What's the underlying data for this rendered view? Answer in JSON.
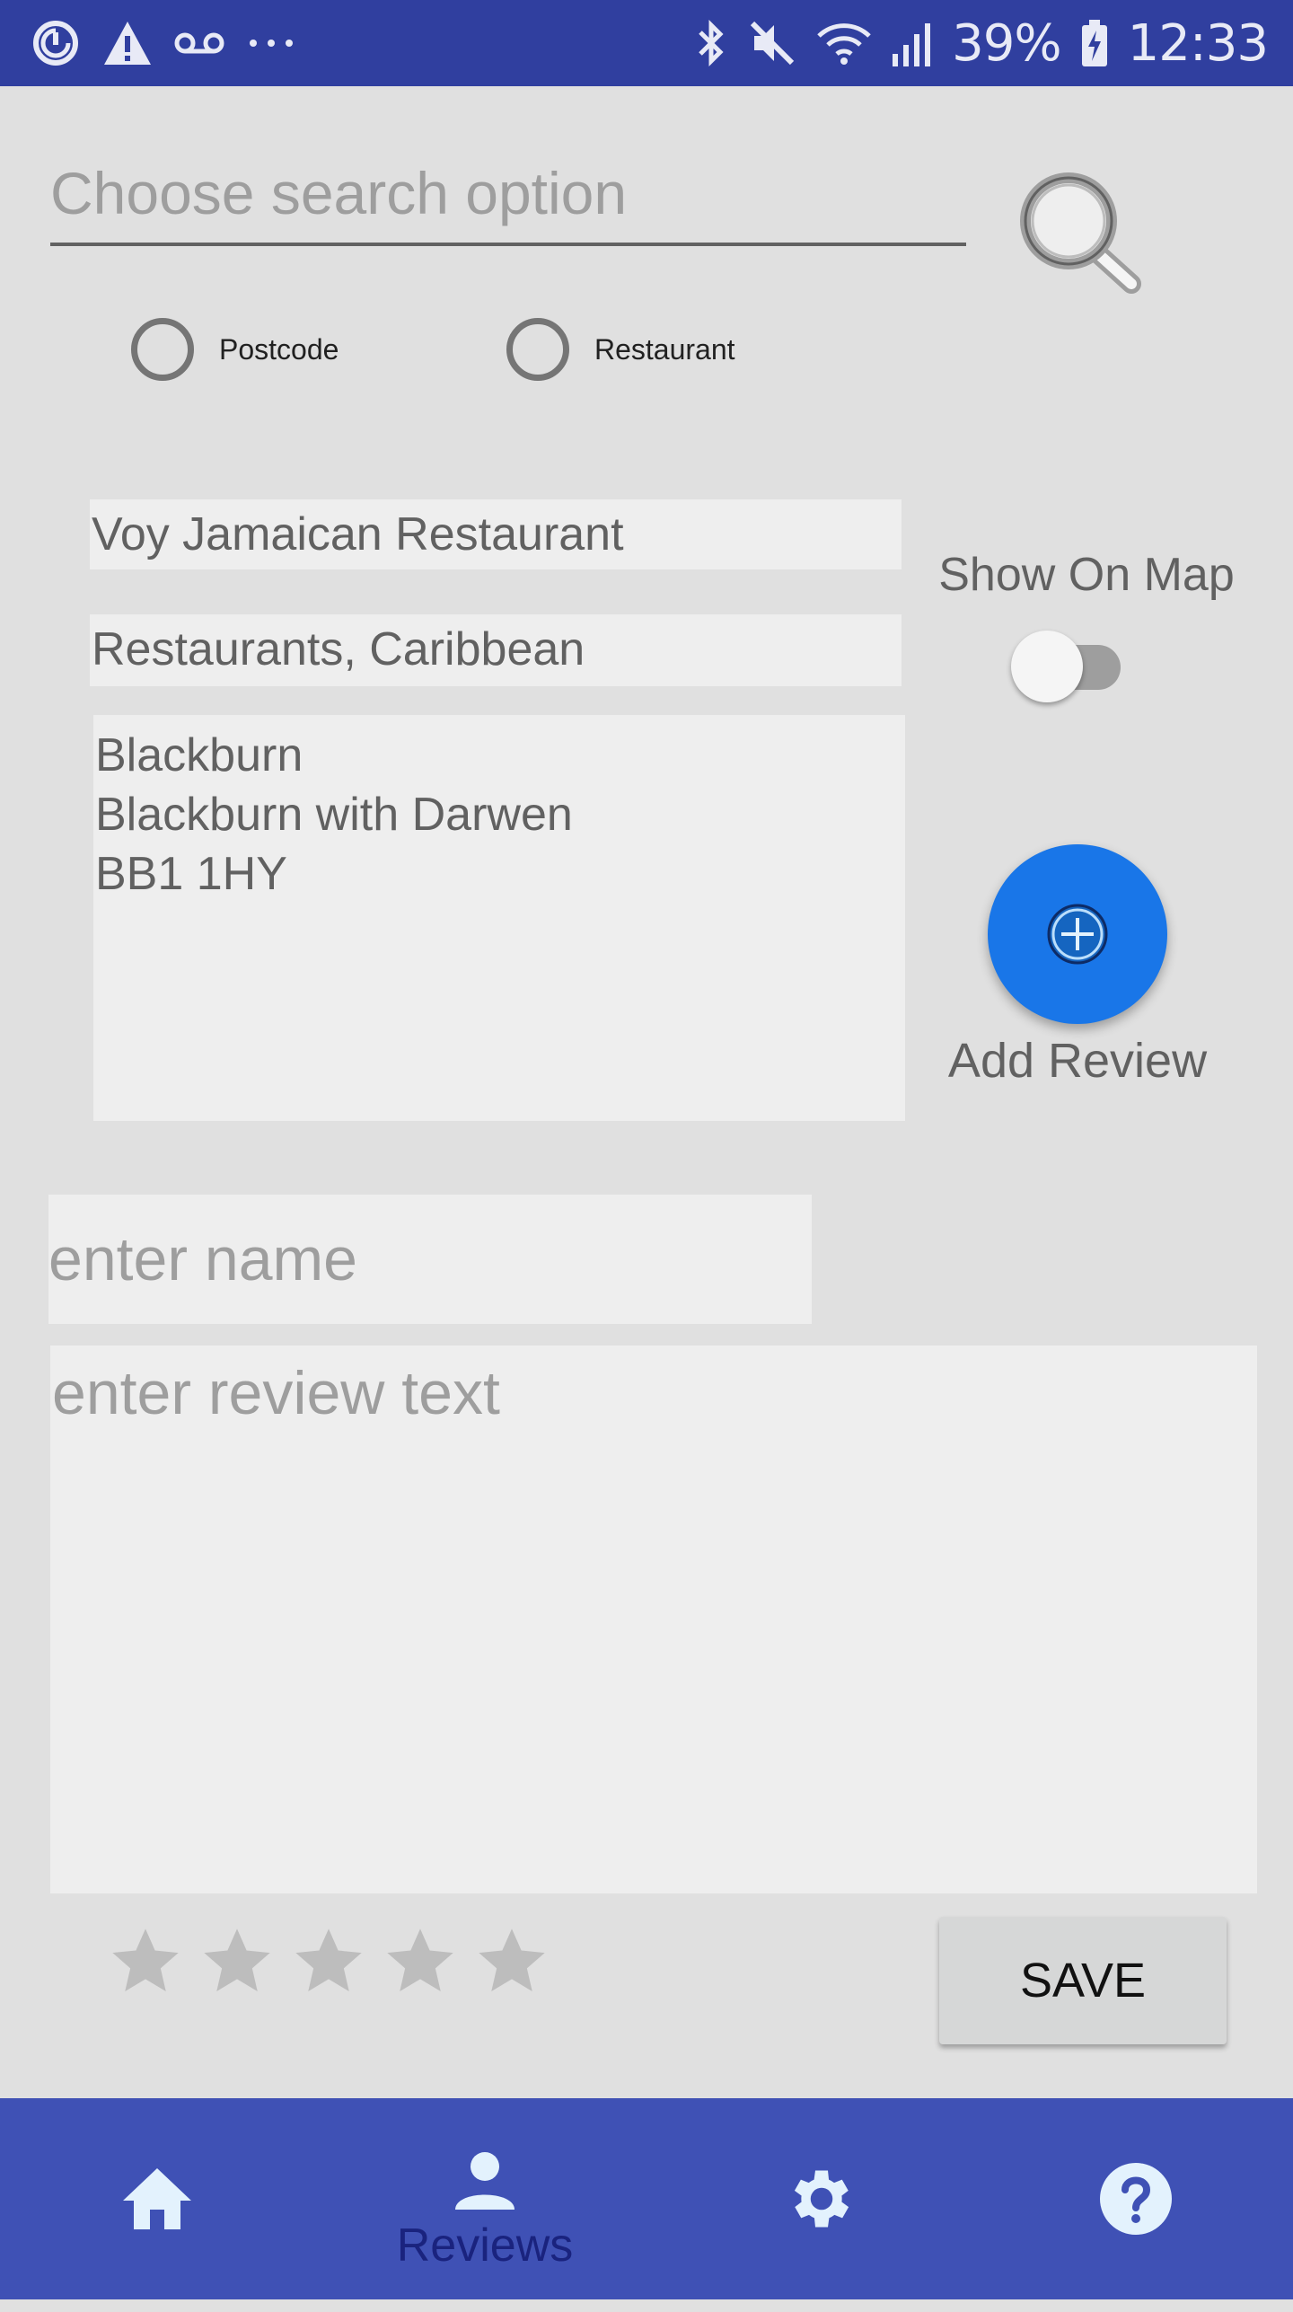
{
  "status_bar": {
    "battery": "39%",
    "time": "12:33",
    "icons": [
      "sync-icon",
      "warning-icon",
      "voicemail-icon",
      "more-icon",
      "bluetooth-icon",
      "mute-icon",
      "wifi-icon",
      "signal-icon",
      "battery-icon"
    ]
  },
  "search": {
    "placeholder": "Choose search option",
    "button_icon": "search-icon",
    "options": [
      {
        "label": "Postcode",
        "selected": false
      },
      {
        "label": "Restaurant",
        "selected": false
      }
    ]
  },
  "restaurant": {
    "name": "Voy Jamaican  Restaurant",
    "category": "Restaurants, Caribbean",
    "address": "Blackburn\nBlackburn with Darwen\nBB1 1HY"
  },
  "map": {
    "label": "Show On Map",
    "enabled": false
  },
  "add_review": {
    "label": "Add Review",
    "icon": "add-circle-icon",
    "color": "#1976e8"
  },
  "review_form": {
    "name_placeholder": "enter name",
    "text_placeholder": "enter review text",
    "rating": 0,
    "max_rating": 5,
    "save_label": "SAVE"
  },
  "bottom_nav": {
    "items": [
      {
        "icon": "home-icon",
        "label": ""
      },
      {
        "icon": "person-icon",
        "label": "Reviews"
      },
      {
        "icon": "gear-icon",
        "label": ""
      },
      {
        "icon": "help-icon",
        "label": ""
      }
    ],
    "active_index": 1,
    "color": "#3f51b5"
  }
}
